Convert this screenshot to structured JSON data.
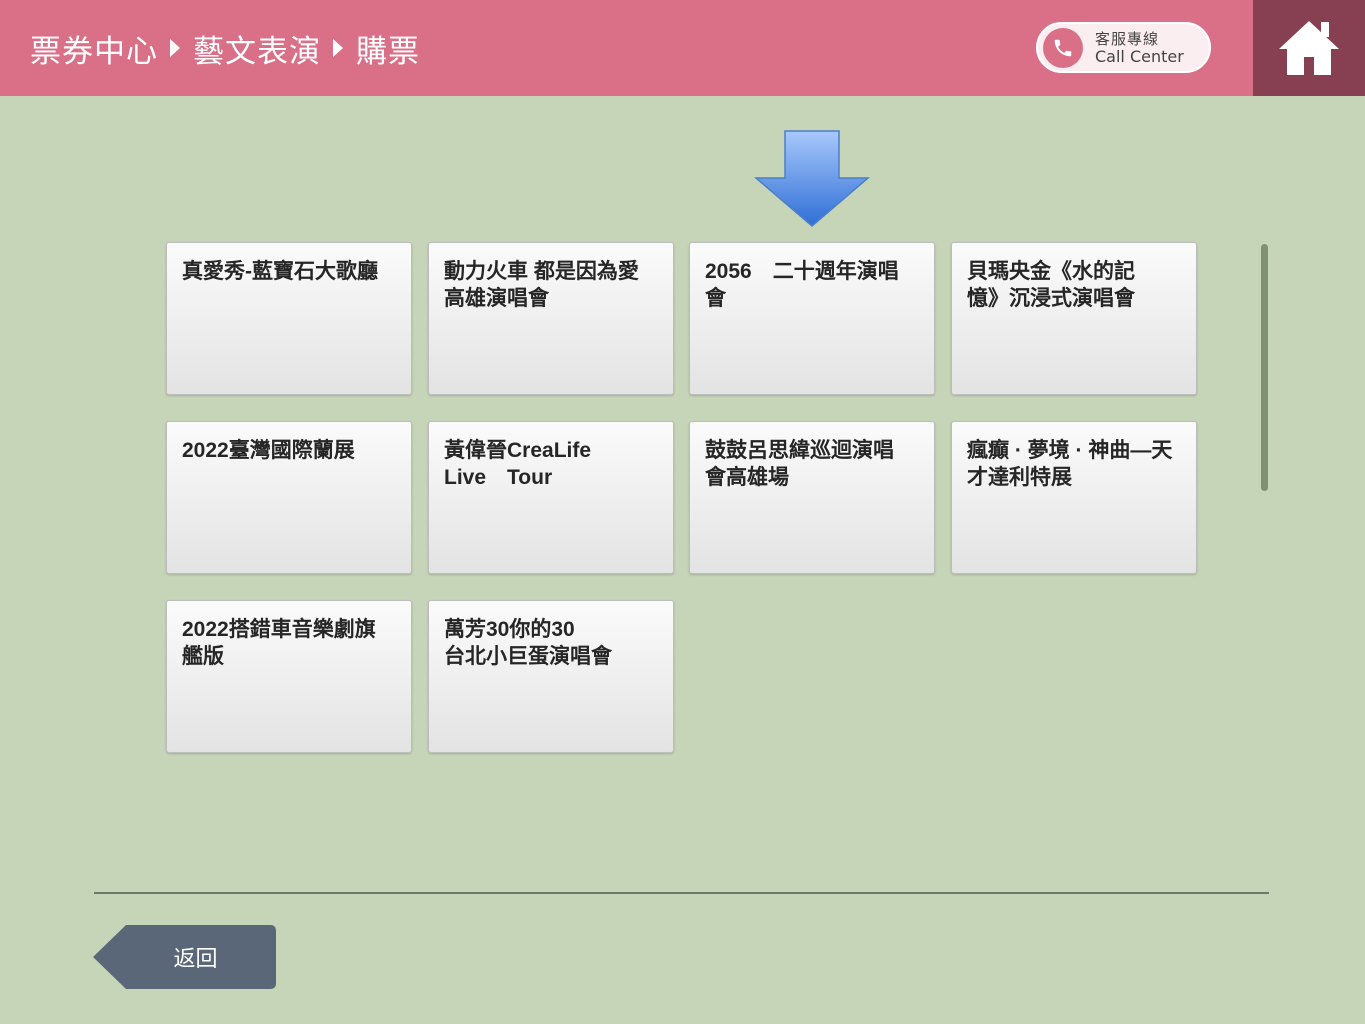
{
  "breadcrumb": [
    {
      "label": "票券中心"
    },
    {
      "label": "藝文表演"
    },
    {
      "label": "購票"
    }
  ],
  "call_center": {
    "label_zh": "客服專線",
    "label_en": "Call Center"
  },
  "events": [
    {
      "title": "真愛秀-藍寶石大歌廳"
    },
    {
      "title": "動力火車 都是因為愛\n高雄演唱會"
    },
    {
      "title": "2056　二十週年演唱\n會"
    },
    {
      "title": "貝瑪央金《水的記\n憶》沉浸式演唱會"
    },
    {
      "title": "2022臺灣國際蘭展"
    },
    {
      "title": "黃偉晉CreaLife\nLive　Tour"
    },
    {
      "title": "鼓鼓呂思緯巡迴演唱\n會高雄場"
    },
    {
      "title": "瘋癲 · 夢境 · 神曲—天\n才達利特展"
    },
    {
      "title": "2022搭錯車音樂劇旗\n艦版"
    },
    {
      "title": "萬芳30你的30\n台北小巨蛋演唱會"
    }
  ],
  "back_button": {
    "label": "返回"
  },
  "colors": {
    "header": "#d97088",
    "home": "#873f52",
    "background": "#c6d5b7",
    "back_button": "#5a6779",
    "arrow": "#3f7fe0"
  }
}
